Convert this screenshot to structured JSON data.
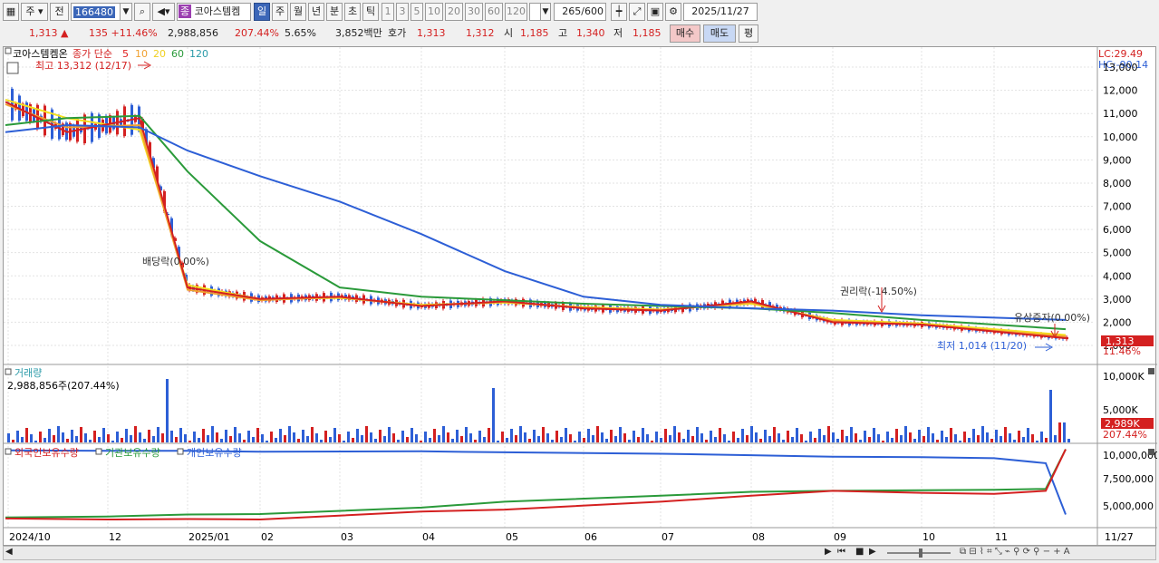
{
  "toolbar": {
    "period_label": "주",
    "prefix_label": "전",
    "stock_code": "166480",
    "mode_label": "종",
    "stock_name": "코아스템켐",
    "timeframes": [
      "일",
      "주",
      "월",
      "년",
      "분",
      "초",
      "틱"
    ],
    "selected_timeframe": "일",
    "intervals": [
      "1",
      "3",
      "5",
      "10",
      "20",
      "30",
      "60",
      "120"
    ],
    "count": "265",
    "count_total": "/600",
    "date": "2025/11/27"
  },
  "info_bar": {
    "price": "1,313",
    "change": "135",
    "change_pct": "+11.46%",
    "volume": "2,988,856",
    "volume_ratio": "207.44%",
    "turnover": "5.65%",
    "amount": "3,852백만",
    "quote_label": "호가",
    "ask": "1,313",
    "bid": "1,312",
    "open_label": "시",
    "open": "1,185",
    "high_label": "고",
    "high": "1,340",
    "low_label": "저",
    "low": "1,185",
    "buy_label": "매수",
    "sell_label": "매도",
    "eval_label": "평"
  },
  "price_panel": {
    "stock_label": "코아스템켐온",
    "legend_prefix": "종가 단순",
    "ma_periods": [
      {
        "label": "5",
        "color": "#e02020"
      },
      {
        "label": "10",
        "color": "#f0a030"
      },
      {
        "label": "20",
        "color": "#f0d020"
      },
      {
        "label": "60",
        "color": "#2a9a3a"
      },
      {
        "label": "120",
        "color": "#2a9aa8"
      }
    ],
    "high_marker": "최고 13,312 (12/17)",
    "low_marker": "최저 1,014 (11/20)",
    "dividend_note": "배당락(0.00%)",
    "rights_note": "권리락(-14.50%)",
    "capital_note": "유상증자(0.00%)",
    "lc": "LC:29.49",
    "hc": "HC:-90.14",
    "current_price": "1,313",
    "current_pct": "11.46%",
    "y_ticks": [
      "13,000",
      "12,000",
      "11,000",
      "10,000",
      "9,000",
      "8,000",
      "7,000",
      "6,000",
      "5,000",
      "4,000",
      "3,000",
      "2,000",
      "1,000"
    ]
  },
  "volume_panel": {
    "title": "거래량",
    "value_text": "2,988,856주(207.44%)",
    "y_ticks": [
      "10,000K",
      "5,000K"
    ],
    "current": "2,989K",
    "current_pct": "207.44%"
  },
  "holdings_panel": {
    "series": [
      {
        "name": "외국인보유수량",
        "color": "#d42020"
      },
      {
        "name": "기관보유수량",
        "color": "#2a9a3a"
      },
      {
        "name": "개인보유수량",
        "color": "#2d5fd6"
      }
    ],
    "y_ticks": [
      "10,000,000",
      "7,500,000",
      "5,000,000"
    ]
  },
  "x_axis": {
    "labels": [
      "2024/10",
      "12",
      "2025/01",
      "02",
      "03",
      "04",
      "05",
      "06",
      "07",
      "08",
      "09",
      "10",
      "11"
    ],
    "end_label": "11/27"
  },
  "chart_data": {
    "type": "line",
    "title": "",
    "x": [
      "2024/10",
      "2024/11",
      "2024/12",
      "2025/01",
      "2025/02",
      "2025/03",
      "2025/04",
      "2025/05",
      "2025/06",
      "2025/07",
      "2025/08",
      "2025/09",
      "2025/10",
      "2025/11/27"
    ],
    "series": [
      {
        "name": "5",
        "values": [
          11500,
          10200,
          10800,
          3500,
          3000,
          3100,
          2700,
          2900,
          2600,
          2500,
          2900,
          2000,
          1900,
          1313
        ]
      },
      {
        "name": "60",
        "values": [
          10500,
          10800,
          10900,
          8500,
          5500,
          3500,
          3100,
          2950,
          2800,
          2700,
          2600,
          2400,
          2100,
          1700
        ]
      },
      {
        "name": "120",
        "values": [
          10200,
          10500,
          10400,
          9400,
          8300,
          7200,
          5800,
          4200,
          3100,
          2750,
          2600,
          2500,
          2300,
          2100
        ]
      }
    ],
    "ylim": [
      1000,
      13500
    ]
  }
}
